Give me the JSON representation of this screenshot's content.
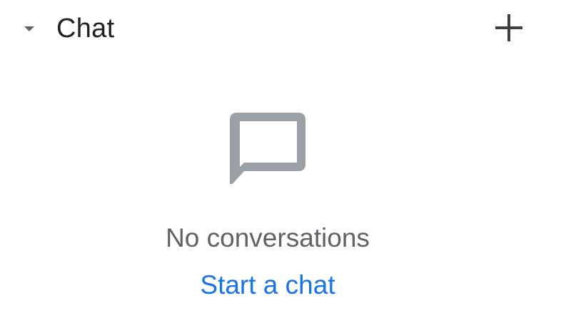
{
  "section": {
    "title": "Chat",
    "toggle_icon": "arrow-drop-down-icon",
    "add_icon": "plus-icon"
  },
  "empty_state": {
    "icon": "chat-bubble-outline-icon",
    "message": "No conversations",
    "action_label": "Start a chat"
  },
  "colors": {
    "title": "#202124",
    "muted_text": "#5f6368",
    "icon_gray": "#9aa0a6",
    "link": "#1a73e8"
  }
}
